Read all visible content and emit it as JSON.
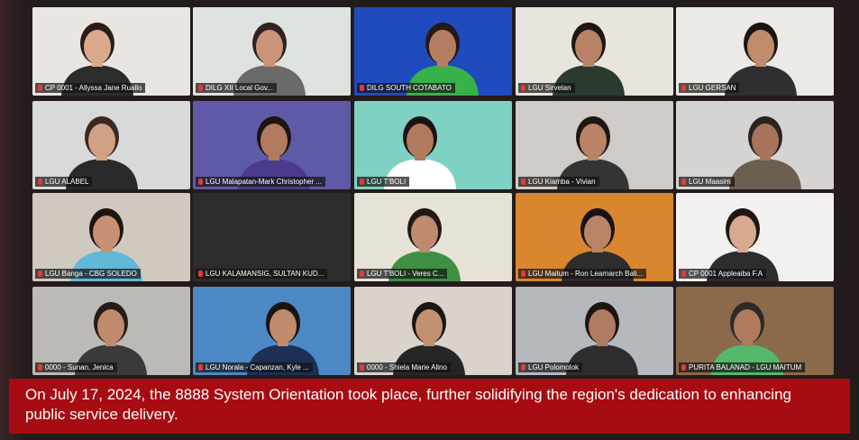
{
  "tiles": [
    {
      "name": "CP 0001 - Allyssa Jane Ruallo",
      "bg": "#e9e6e1",
      "skin": "#d9a98c",
      "hair": "#2b1d18",
      "shirt": "#2c2c2c"
    },
    {
      "name": "DILG XII Local Gov...",
      "bg": "#dfe3df",
      "skin": "#c99477",
      "hair": "#2d2320",
      "shirt": "#6a6a6a"
    },
    {
      "name": "DILG SOUTH COTABATO",
      "bg": "#1f4bbf",
      "skin": "#b57d62",
      "hair": "#241915",
      "shirt": "#37b24a"
    },
    {
      "name": "LGU Sirvelan",
      "bg": "#e8e4de",
      "skin": "#b98266",
      "hair": "#1f1714",
      "shirt": "#2b3a2f"
    },
    {
      "name": "LGU GERSAN",
      "bg": "#eceae6",
      "skin": "#c18b6e",
      "hair": "#1b1412",
      "shirt": "#2f2f2f"
    },
    {
      "name": "LGU ALABEL",
      "bg": "#d7dad8",
      "skin": "#d1a085",
      "hair": "#3b2a22",
      "shirt": "#2a2a2a"
    },
    {
      "name": "LGU Malapatan-Mark Christopher ...",
      "bg": "#5f5aa8",
      "skin": "#b27a5e",
      "hair": "#1d1512",
      "shirt": "#4a3b8c"
    },
    {
      "name": "LGU T'BOLI",
      "bg": "#7fd1c4",
      "skin": "#b07a5f",
      "hair": "#1b1412",
      "shirt": "#ffffff"
    },
    {
      "name": "LGU Kiamba - Vivian",
      "bg": "#cfcbc6",
      "skin": "#b98466",
      "hair": "#1e1613",
      "shirt": "#343434"
    },
    {
      "name": "LGU Maasim",
      "bg": "#d6d4d2",
      "skin": "#a8735a",
      "hair": "#2a2320",
      "shirt": "#6b5f52"
    },
    {
      "name": "LGU Banga - CBG SOLEDO",
      "bg": "#cfc9bf",
      "skin": "#c79073",
      "hair": "#1d1512",
      "shirt": "#62b7d8"
    },
    {
      "name": "LGU KALAMANSIG, SULTAN KUD...",
      "bg": "#2c2c2c",
      "skin": "",
      "hair": "",
      "shirt": ""
    },
    {
      "name": "LGU T'BOLI - Veres C...",
      "bg": "#e7e2d6",
      "skin": "#bf8a6d",
      "hair": "#221915",
      "shirt": "#3f8f45"
    },
    {
      "name": "LGU Maitum - Ron Learnarch Bali...",
      "bg": "#d9872e",
      "skin": "#ba8467",
      "hair": "#1a1311",
      "shirt": "#2d2d2d"
    },
    {
      "name": "CP 0001 Appleaiba F.A",
      "bg": "#f2f1ef",
      "skin": "#d8a98e",
      "hair": "#1f1614",
      "shirt": "#2d2d2d"
    },
    {
      "name": "0000 - Sunan, Jenica",
      "bg": "#bcbab5",
      "skin": "#c08a6c",
      "hair": "#251b17",
      "shirt": "#3a3a3a"
    },
    {
      "name": "LGU Norala - Capanzan, Kyle ...",
      "bg": "#4c88c4",
      "skin": "#c08a6d",
      "hair": "#1a1411",
      "shirt": "#1e2f55"
    },
    {
      "name": "0000 - Shiela Marie Alino",
      "bg": "#d9d3cc",
      "skin": "#c39071",
      "hair": "#1c1512",
      "shirt": "#262626"
    },
    {
      "name": "LGU Polomolok",
      "bg": "#b5b8bd",
      "skin": "#b17b61",
      "hair": "#1b1411",
      "shirt": "#2e2e2e"
    },
    {
      "name": "PURITA BALANAD - LGU MAITUM",
      "bg": "#8a6a4a",
      "skin": "#b07a5c",
      "hair": "#2b2a28",
      "shirt": "#53b86a"
    }
  ],
  "caption": "On July 17, 2024, the 8888 System Orientation took place, further solidifying the region's dedication to enhancing public service delivery."
}
